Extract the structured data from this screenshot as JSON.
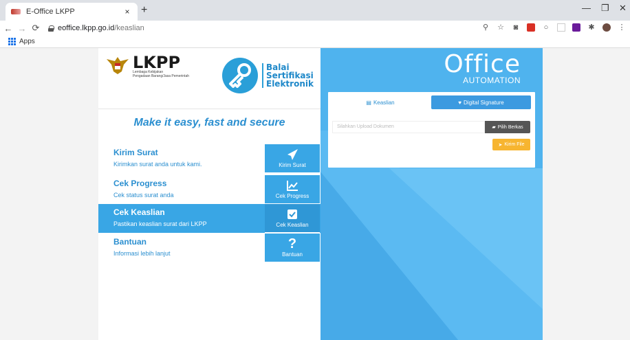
{
  "browser": {
    "tab_title": "E-Office LKPP",
    "tab_close": "×",
    "new_tab": "+",
    "url_host": "eoffice.lkpp.go.id",
    "url_path": "/keaslian",
    "bookmarks_apps": "Apps",
    "window_minimize": "—",
    "window_maximize": "❐",
    "window_close": "✕"
  },
  "header": {
    "lkpp_brand": "LKPP",
    "lkpp_sub1": "Lembaga Kebijakan",
    "lkpp_sub2": "Pengadaan Barang/Jasa Pemerintah",
    "bse_line1": "Balai",
    "bse_line2": "Sertifikasi",
    "bse_line3": "Elektronik",
    "tagline": "Make it easy, fast and secure"
  },
  "menu": {
    "items": [
      {
        "title": "Kirim Surat",
        "desc": "Kirimkan surat anda untuk kami.",
        "button": "Kirim Surat",
        "icon": "paper-plane-icon"
      },
      {
        "title": "Cek Progress",
        "desc": "Cek status surat anda",
        "button": "Cek Progress",
        "icon": "chart-icon"
      },
      {
        "title": "Cek Keaslian",
        "desc": "Pastikan keaslian surat dari LKPP",
        "button": "Cek Keaslian",
        "icon": "checkbox-icon"
      },
      {
        "title": "Bantuan",
        "desc": "Informasi lebih lanjut",
        "button": "Bantuan",
        "icon": "question-icon"
      }
    ],
    "active_index": 2
  },
  "office": {
    "big": "Office",
    "small": "AUTOMATION"
  },
  "card": {
    "tab_keaslian": "Keaslian",
    "tab_digital": "Digital Signature",
    "upload_placeholder": "Silahkan Upload Dokumen",
    "pilih_label": "Pilih Berkas",
    "kirim_label": "Kirim File"
  },
  "colors": {
    "primary": "#39a6e5",
    "panel": "#5bbaf2",
    "accent_orange": "#f7b530",
    "lkpp_red": "#c62828"
  }
}
